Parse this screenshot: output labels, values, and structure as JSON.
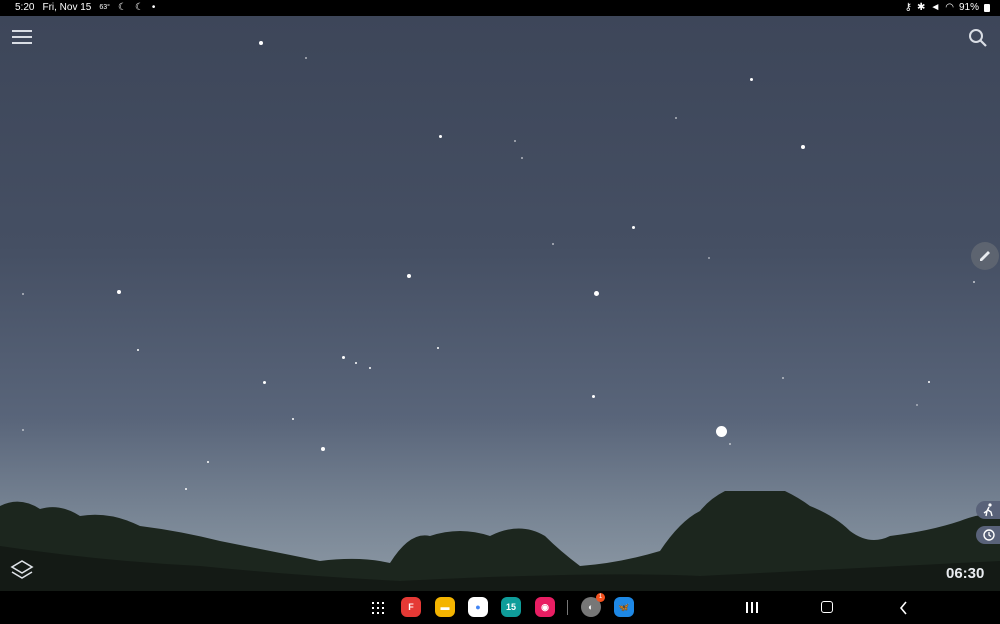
{
  "status_bar": {
    "time": "5:20",
    "date": "Fri, Nov 15",
    "temp": "63°",
    "battery": "91%",
    "icons": [
      "moon-icon",
      "moon-icon",
      "dot-icon",
      "key-icon",
      "no-disturb-icon",
      "bluetooth-icon",
      "mute-icon",
      "wifi-icon",
      "battery-icon"
    ]
  },
  "sky_view": {
    "time_display": "06:30",
    "controls": [
      "menu-icon",
      "search-icon",
      "edit-icon",
      "walk-icon",
      "history-icon",
      "layers-icon"
    ]
  },
  "taskbar": {
    "apps": [
      {
        "name": "Flipboard",
        "color": "#e53935",
        "glyph": "F"
      },
      {
        "name": "Files",
        "color": "#f4b400",
        "glyph": "▬"
      },
      {
        "name": "Chrome",
        "color": "#ffffff",
        "glyph": "●"
      },
      {
        "name": "Calendar",
        "color": "#0f9d9a",
        "glyph": "15"
      },
      {
        "name": "Screen recorder",
        "color": "#e91e63",
        "glyph": "◉"
      },
      {
        "name": "Moon",
        "color": "#888888",
        "glyph": "◐"
      },
      {
        "name": "Bluesky",
        "color": "#1e88e5",
        "glyph": "🦋"
      }
    ],
    "moon_badge": "1"
  },
  "nav_bar": [
    "recents-icon",
    "home-icon",
    "back-icon"
  ]
}
